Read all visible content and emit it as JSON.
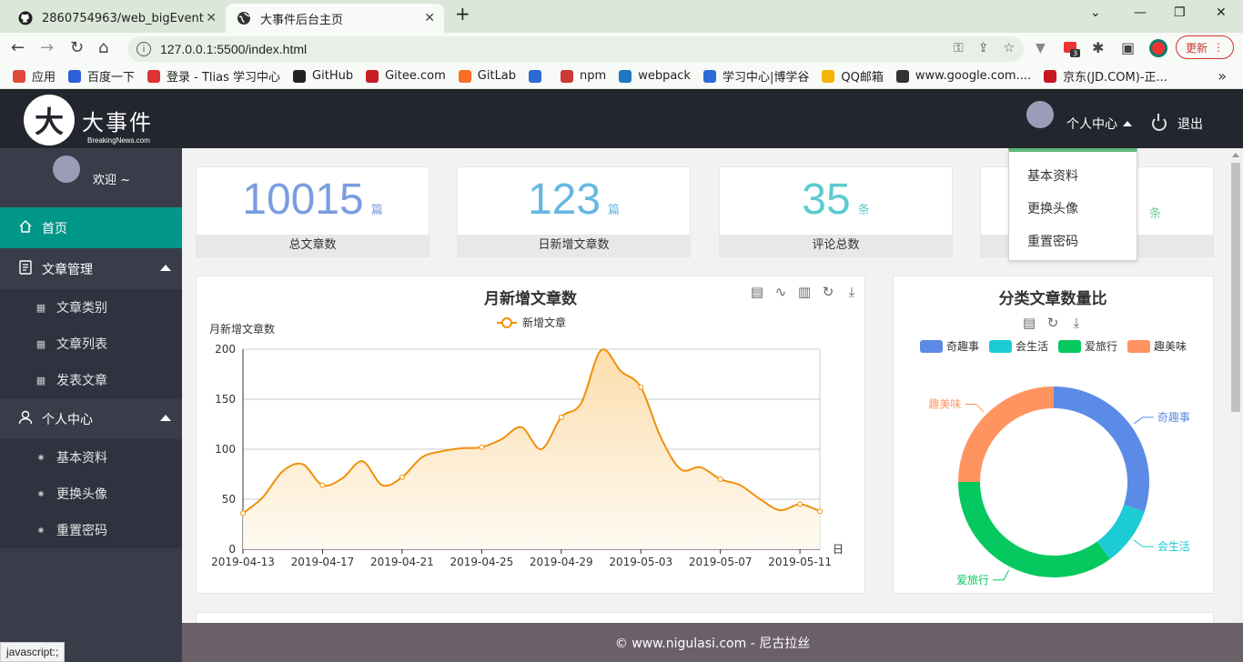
{
  "browser": {
    "tabs": [
      {
        "title": "2860754963/web_bigEvent",
        "icon": "github-icon"
      },
      {
        "title": "大事件后台主页",
        "icon": "globe-icon"
      }
    ],
    "url": "127.0.0.1:5500/index.html",
    "update_label": "更新",
    "extension_badge": "3",
    "bookmarks": [
      {
        "label": "应用",
        "icon": "apps-icon",
        "color": "#e04a3a"
      },
      {
        "label": "百度一下",
        "icon": "baidu-icon",
        "color": "#2d5fd6"
      },
      {
        "label": "登录 - Tlias 学习中心",
        "icon": "tlias-icon",
        "color": "#d33"
      },
      {
        "label": "GitHub",
        "icon": "github-icon",
        "color": "#222"
      },
      {
        "label": "Gitee.com",
        "icon": "gitee-icon",
        "color": "#c71d23"
      },
      {
        "label": "GitLab",
        "icon": "gitlab-icon",
        "color": "#fc6d26"
      },
      {
        "label": "",
        "icon": "link-icon",
        "color": "#2d6ad6"
      },
      {
        "label": "npm",
        "icon": "npm-icon",
        "color": "#cb3837"
      },
      {
        "label": "webpack",
        "icon": "webpack-icon",
        "color": "#1c78c0"
      },
      {
        "label": "学习中心|博学谷",
        "icon": "boxuegu-icon",
        "color": "#2d6ad6"
      },
      {
        "label": "QQ邮箱",
        "icon": "qqmail-icon",
        "color": "#f4b400"
      },
      {
        "label": "www.google.com....",
        "icon": "globe-icon",
        "color": "#333"
      },
      {
        "label": "京东(JD.COM)-正...",
        "icon": "jd-icon",
        "color": "#c81623"
      }
    ],
    "status_tip": "javascript:;"
  },
  "logo": {
    "cn": "大事件",
    "en": "BreakingNews.com",
    "mark": "大"
  },
  "sidebar": {
    "welcome": "欢迎 ~",
    "items": [
      {
        "label": "首页",
        "icon": "home-icon",
        "active": true
      },
      {
        "label": "文章管理",
        "icon": "document-icon",
        "expanded": true,
        "children": [
          {
            "label": "文章类别",
            "icon": "grid-icon"
          },
          {
            "label": "文章列表",
            "icon": "grid-icon"
          },
          {
            "label": "发表文章",
            "icon": "grid-icon"
          }
        ]
      },
      {
        "label": "个人中心",
        "icon": "user-icon",
        "expanded": true,
        "children": [
          {
            "label": "基本资料",
            "icon": "gear-icon"
          },
          {
            "label": "更换头像",
            "icon": "gear-icon"
          },
          {
            "label": "重置密码",
            "icon": "gear-icon"
          }
        ]
      }
    ]
  },
  "header": {
    "user_center": "个人中心",
    "logout": "退出",
    "dropdown": [
      "基本资料",
      "更换头像",
      "重置密码"
    ]
  },
  "stats": [
    {
      "value": "10015",
      "unit": "篇",
      "label": "总文章数",
      "color": "#7a9de0"
    },
    {
      "value": "123",
      "unit": "篇",
      "label": "日新增文章数",
      "color": "#66b8e0"
    },
    {
      "value": "35",
      "unit": "条",
      "label": "评论总数",
      "color": "#5ccbcf"
    },
    {
      "value": "",
      "unit": "条",
      "label": "",
      "color": "#6fcf8f"
    }
  ],
  "footer": "© www.nigulasi.com - 尼古拉丝",
  "colors": {
    "accent": "#009688",
    "line": "#f0900a",
    "dark": "#23262e",
    "sidebar": "#393d49"
  },
  "chart_data": [
    {
      "type": "area",
      "title": "月新增文章数",
      "ylabel": "月新增文章数",
      "xlabel": "日",
      "legend": "top-center",
      "series": [
        {
          "name": "新增文章"
        }
      ],
      "toolbox": [
        "data-view-icon",
        "line-toggle-icon",
        "bar-toggle-icon",
        "restore-icon",
        "download-icon"
      ],
      "ylim": [
        0,
        200
      ],
      "yticks": [
        0,
        50,
        100,
        150,
        200
      ],
      "xticks": [
        "2019-04-13",
        "2019-04-17",
        "2019-04-21",
        "2019-04-25",
        "2019-04-29",
        "2019-05-03",
        "2019-05-07",
        "2019-05-11"
      ],
      "x_dates": [
        "2019-04-13",
        "2019-04-14",
        "2019-04-15",
        "2019-04-16",
        "2019-04-17",
        "2019-04-18",
        "2019-04-19",
        "2019-04-20",
        "2019-04-21",
        "2019-04-22",
        "2019-04-23",
        "2019-04-24",
        "2019-04-25",
        "2019-04-26",
        "2019-04-27",
        "2019-04-28",
        "2019-04-29",
        "2019-04-30",
        "2019-05-01",
        "2019-05-02",
        "2019-05-03",
        "2019-05-04",
        "2019-05-05",
        "2019-05-06",
        "2019-05-07",
        "2019-05-08",
        "2019-05-09",
        "2019-05-10",
        "2019-05-11",
        "2019-05-12"
      ],
      "values": [
        36,
        52,
        78,
        85,
        64,
        71,
        88,
        64,
        72,
        92,
        98,
        101,
        102,
        110,
        122,
        100,
        132,
        146,
        199,
        178,
        162,
        112,
        80,
        82,
        70,
        64,
        50,
        39,
        45,
        38
      ],
      "grid": true,
      "smooth": true
    },
    {
      "type": "pie",
      "title": "分类文章数量比",
      "legend": "top-center",
      "toolbox": [
        "data-view-icon",
        "restore-icon",
        "download-icon"
      ],
      "categories": [
        "奇趣事",
        "会生活",
        "爱旅行",
        "趣美味"
      ],
      "values": [
        30,
        10,
        35,
        25
      ],
      "colors": [
        "#5b8be6",
        "#1ccbd3",
        "#05c95e",
        "#ff9461"
      ],
      "donut": true
    }
  ]
}
